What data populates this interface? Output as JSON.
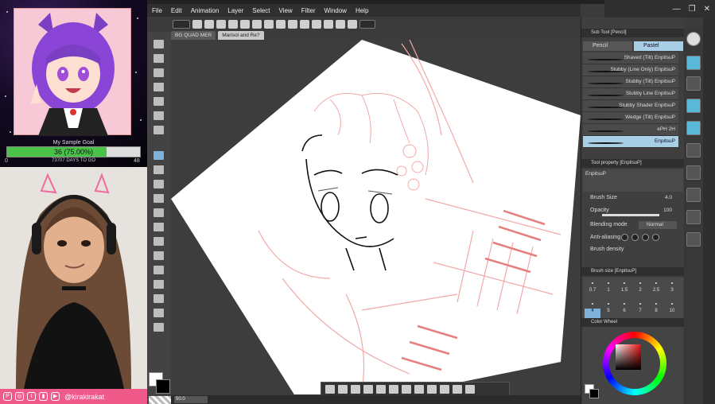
{
  "overlay": {
    "goal": {
      "label": "My Sample Goal",
      "progress_text": "36 (75.00%)",
      "progress_fraction": 0.75,
      "start": "0",
      "days_to_go": "73707 DAYS TO GO",
      "target": "48"
    },
    "social": {
      "icons": [
        "patreon-icon",
        "instagram-icon",
        "twitter-icon",
        "twitch-icon",
        "youtube-icon"
      ],
      "handle": "@kirakirakat",
      "color": "#f05a8a"
    }
  },
  "app": {
    "menu": [
      "File",
      "Edit",
      "Animation",
      "Layer",
      "Select",
      "View",
      "Filter",
      "Window",
      "Help"
    ],
    "tabs": [
      {
        "label": "BG QUAD MER",
        "active": false
      },
      {
        "label": "Marisol and Re?",
        "active": true
      }
    ],
    "zoom": "50.0",
    "window_controls": [
      "—",
      "❐",
      "✕"
    ],
    "sub_tool": {
      "header": "Sub Tool [Pencil]",
      "tabs": [
        "Pencil",
        "Pastel"
      ],
      "brushes": [
        "Shaved (Tilt) EnpitsuP",
        "Stubby (Line Only) EnpitsuP",
        "Stubby (Tilt) EnpitsuP",
        "Stubby Line EnpitsuP",
        "Stubby Shader EnpitsuP",
        "Wedge (Tilt) EnpitsuP",
        "ePH 2H",
        "EnpitsuP"
      ]
    },
    "tool_property": {
      "header": "Tool property [EnpitsuP]",
      "name": "EnpitsuP",
      "brush_size_label": "Brush Size",
      "brush_size_value": "4.0",
      "opacity_label": "Opacity",
      "opacity_value": "100",
      "blending_label": "Blending mode",
      "blending_value": "Normal",
      "antialias_label": "Anti-aliasing",
      "density_label": "Brush density"
    },
    "brush_size_panel": {
      "header": "Brush size [EnpitsuP]",
      "row1": [
        "0.7",
        "1",
        "1.5",
        "2",
        "2.5",
        "3"
      ],
      "row2": [
        "4",
        "5",
        "6",
        "7",
        "8",
        "10"
      ],
      "selected": "4"
    },
    "color_wheel": {
      "header": "Color Wheel",
      "hue": "#e11"
    }
  }
}
